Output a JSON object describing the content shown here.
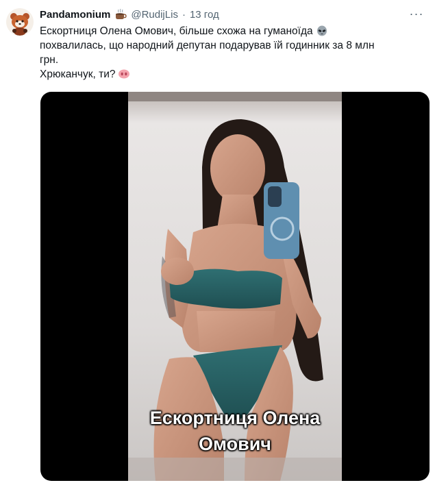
{
  "tweet": {
    "author": {
      "display_name": "Pandamonium",
      "name_emoji": "hot-beverage-icon",
      "handle": "@RudijLis",
      "separator": "·",
      "time": "13 год"
    },
    "more_label": "···",
    "text": {
      "line1": "Ескортниця Олена Омович, більше схожа на гуманоїда",
      "line1_emoji": "alien-icon",
      "line2": "похвалилась, що народний депутан подарував їй годинник за 8 млн",
      "line3": "грн.",
      "line4": "Хрюканчук, ти?",
      "line4_emoji": "pig-nose-icon"
    },
    "media": {
      "caption_line1": "Ескортниця Олена",
      "caption_line2": "Омович"
    }
  },
  "colors": {
    "text_primary": "#0f1419",
    "text_secondary": "#536471",
    "media_background": "#000000"
  }
}
